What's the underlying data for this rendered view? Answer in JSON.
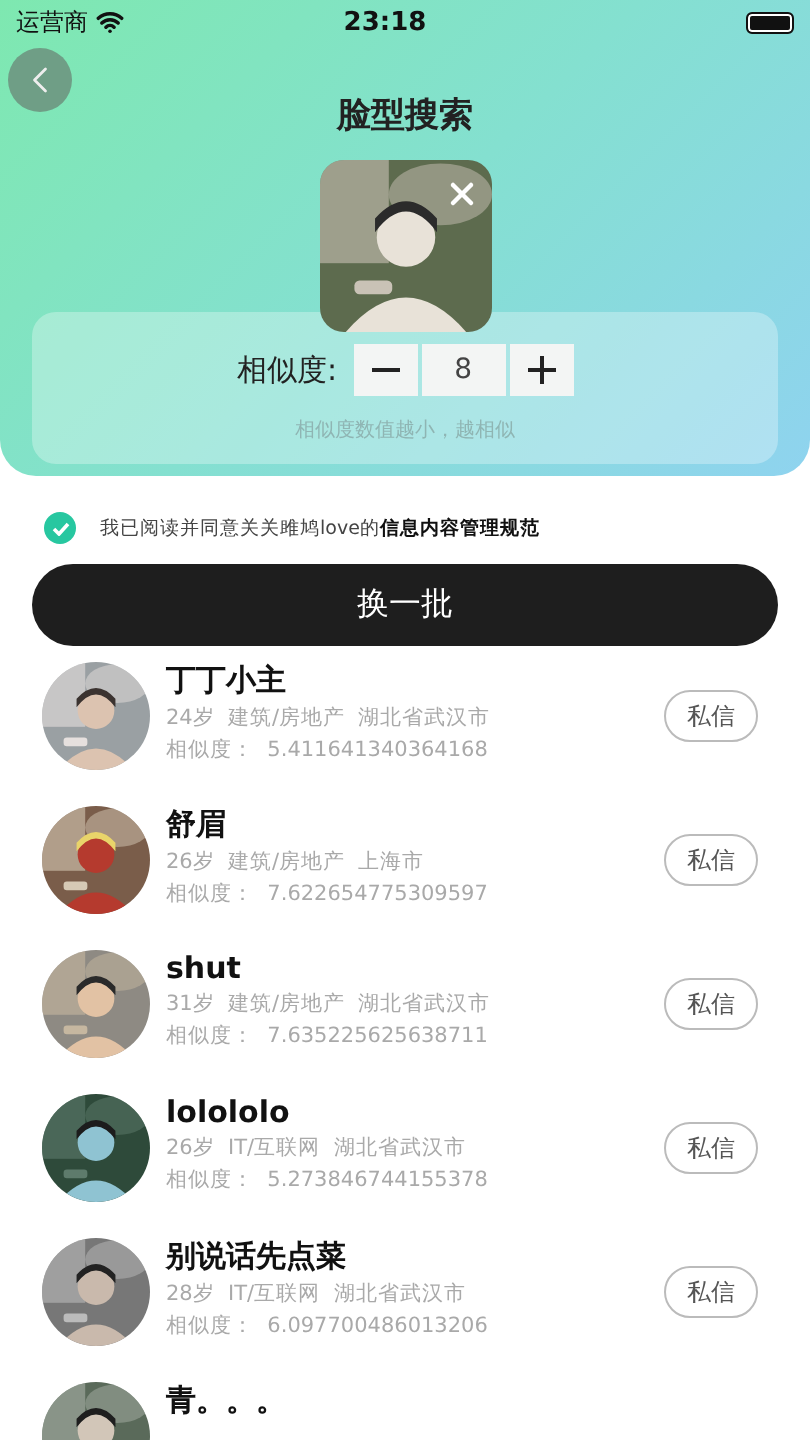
{
  "status_bar": {
    "carrier": "运营商",
    "time": "23:18"
  },
  "title": "脸型搜索",
  "similarity": {
    "label": "相似度:",
    "value": "8",
    "hint": "相似度数值越小，越相似"
  },
  "agreement": {
    "checked": true,
    "text": "我已阅读并同意关关雎鸠love的**信息内容管理规范**"
  },
  "refresh_button": "换一批",
  "users": [
    {
      "name": "丁丁小主",
      "info": "24岁  建筑/房地产  湖北省武汉市",
      "similarity": "相似度：  5.411641340364168",
      "action": "私信"
    },
    {
      "name": "舒眉",
      "info": "26岁  建筑/房地产  上海市",
      "similarity": "相似度：  7.622654775309597",
      "action": "私信"
    },
    {
      "name": "shut",
      "info": "31岁  建筑/房地产  湖北省武汉市",
      "similarity": "相似度：  7.635225625638711",
      "action": "私信"
    },
    {
      "name": "lolololo",
      "info": "26岁  IT/互联网  湖北省武汉市",
      "similarity": "相似度：  5.273846744155378",
      "action": "私信"
    },
    {
      "name": "别说话先点菜",
      "info": "28岁  IT/互联网  湖北省武汉市",
      "similarity": "相似度：  6.097700486013206",
      "action": "私信"
    },
    {
      "name": "青。。。"
    }
  ]
}
